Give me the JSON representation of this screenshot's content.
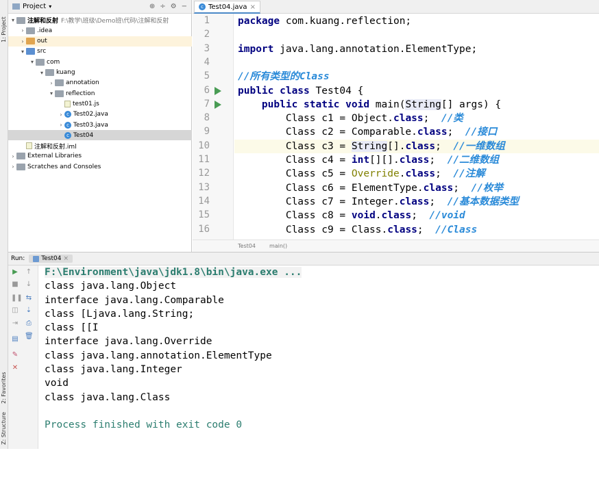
{
  "side_tabs": {
    "project": "1: Project",
    "favorites": "2: Favorites",
    "structure": "Z: Structure"
  },
  "project": {
    "title": "Project",
    "tree": [
      {
        "label": "注解和反射",
        "path": "F:\\教学\\班级\\Demo班\\代码\\注解和反射",
        "indent": 0,
        "arrow": "▾",
        "icon": "folder-gray"
      },
      {
        "label": ".idea",
        "indent": 1,
        "arrow": "›",
        "icon": "folder-gray"
      },
      {
        "label": "out",
        "indent": 1,
        "arrow": "›",
        "icon": "folder-orange",
        "highlight": true
      },
      {
        "label": "src",
        "indent": 1,
        "arrow": "▾",
        "icon": "folder-blue"
      },
      {
        "label": "com",
        "indent": 2,
        "arrow": "▾",
        "icon": "folder-gray"
      },
      {
        "label": "kuang",
        "indent": 3,
        "arrow": "▾",
        "icon": "folder-gray"
      },
      {
        "label": "annotation",
        "indent": 4,
        "arrow": "›",
        "icon": "folder-gray"
      },
      {
        "label": "reflection",
        "indent": 4,
        "arrow": "▾",
        "icon": "folder-gray"
      },
      {
        "label": "test01.js",
        "indent": 5,
        "arrow": "",
        "icon": "file"
      },
      {
        "label": "Test02.java",
        "indent": 5,
        "arrow": "›",
        "icon": "java"
      },
      {
        "label": "Test03.java",
        "indent": 5,
        "arrow": "›",
        "icon": "java"
      },
      {
        "label": "Test04",
        "indent": 5,
        "arrow": "",
        "icon": "java",
        "selected": true
      },
      {
        "label": "注解和反射.iml",
        "indent": 1,
        "arrow": "",
        "icon": "file"
      },
      {
        "label": "External Libraries",
        "indent": 0,
        "arrow": "›",
        "icon": "folder-gray"
      },
      {
        "label": "Scratches and Consoles",
        "indent": 0,
        "arrow": "›",
        "icon": "folder-gray"
      }
    ]
  },
  "editor": {
    "tab": "Test04.java",
    "breadcrumb": [
      "Test04",
      "main()"
    ],
    "lines": [
      {
        "n": "1",
        "html": "<span class='kw'>package</span> com.kuang.reflection;"
      },
      {
        "n": "2",
        "html": ""
      },
      {
        "n": "3",
        "html": "<span class='kw'>import</span> java.lang.annotation.ElementType;"
      },
      {
        "n": "4",
        "html": ""
      },
      {
        "n": "5",
        "html": "<span class='cm'>//所有类型的Class</span>"
      },
      {
        "n": "6",
        "html": "<span class='kw'>public class</span> Test04 {",
        "run": true
      },
      {
        "n": "7",
        "html": "    <span class='kw'>public static void</span> main(<span class='sel'>String</span>[] args) {",
        "run": true
      },
      {
        "n": "8",
        "html": "        Class c1 = Object.<span class='kw'>class</span>;  <span class='cm'>//类</span>"
      },
      {
        "n": "9",
        "html": "        Class c2 = Comparable.<span class='kw'>class</span>;  <span class='cm'>//接口</span>"
      },
      {
        "n": "10",
        "html": "        Class c3 = <span class='sel'>String</span>[].<span class='kw'>class</span>;  <span class='cm'>//一维数组</span>",
        "current": true
      },
      {
        "n": "11",
        "html": "        Class c4 = <span class='kw'>int</span>[][].<span class='kw'>class</span>;  <span class='cm'>//二维数组</span>"
      },
      {
        "n": "12",
        "html": "        Class c5 = <span class='ann'>Override</span>.<span class='kw'>class</span>;  <span class='cm'>//注解</span>"
      },
      {
        "n": "13",
        "html": "        Class c6 = ElementType.<span class='kw'>class</span>;  <span class='cm'>//枚举</span>"
      },
      {
        "n": "14",
        "html": "        Class c7 = Integer.<span class='kw'>class</span>;  <span class='cm'>//基本数据类型</span>"
      },
      {
        "n": "15",
        "html": "        Class c8 = <span class='kw'>void</span>.<span class='kw'>class</span>;  <span class='cm'>//void</span>"
      },
      {
        "n": "16",
        "html": "        Class c9 = Class.<span class='kw'>class</span>;  <span class='cm'>//Class</span>"
      }
    ]
  },
  "run": {
    "label": "Run:",
    "tab": "Test04",
    "output": [
      {
        "text": "F:\\Environment\\java\\jdk1.8\\bin\\java.exe ...",
        "kind": "cmd"
      },
      {
        "text": "class java.lang.Object",
        "kind": "out"
      },
      {
        "text": "interface java.lang.Comparable",
        "kind": "out"
      },
      {
        "text": "class [Ljava.lang.String;",
        "kind": "out"
      },
      {
        "text": "class [[I",
        "kind": "out"
      },
      {
        "text": "interface java.lang.Override",
        "kind": "out"
      },
      {
        "text": "class java.lang.annotation.ElementType",
        "kind": "out"
      },
      {
        "text": "class java.lang.Integer",
        "kind": "out"
      },
      {
        "text": "void",
        "kind": "out"
      },
      {
        "text": "class java.lang.Class",
        "kind": "out"
      },
      {
        "text": "",
        "kind": "out"
      },
      {
        "text": "Process finished with exit code 0",
        "kind": "done"
      }
    ]
  }
}
